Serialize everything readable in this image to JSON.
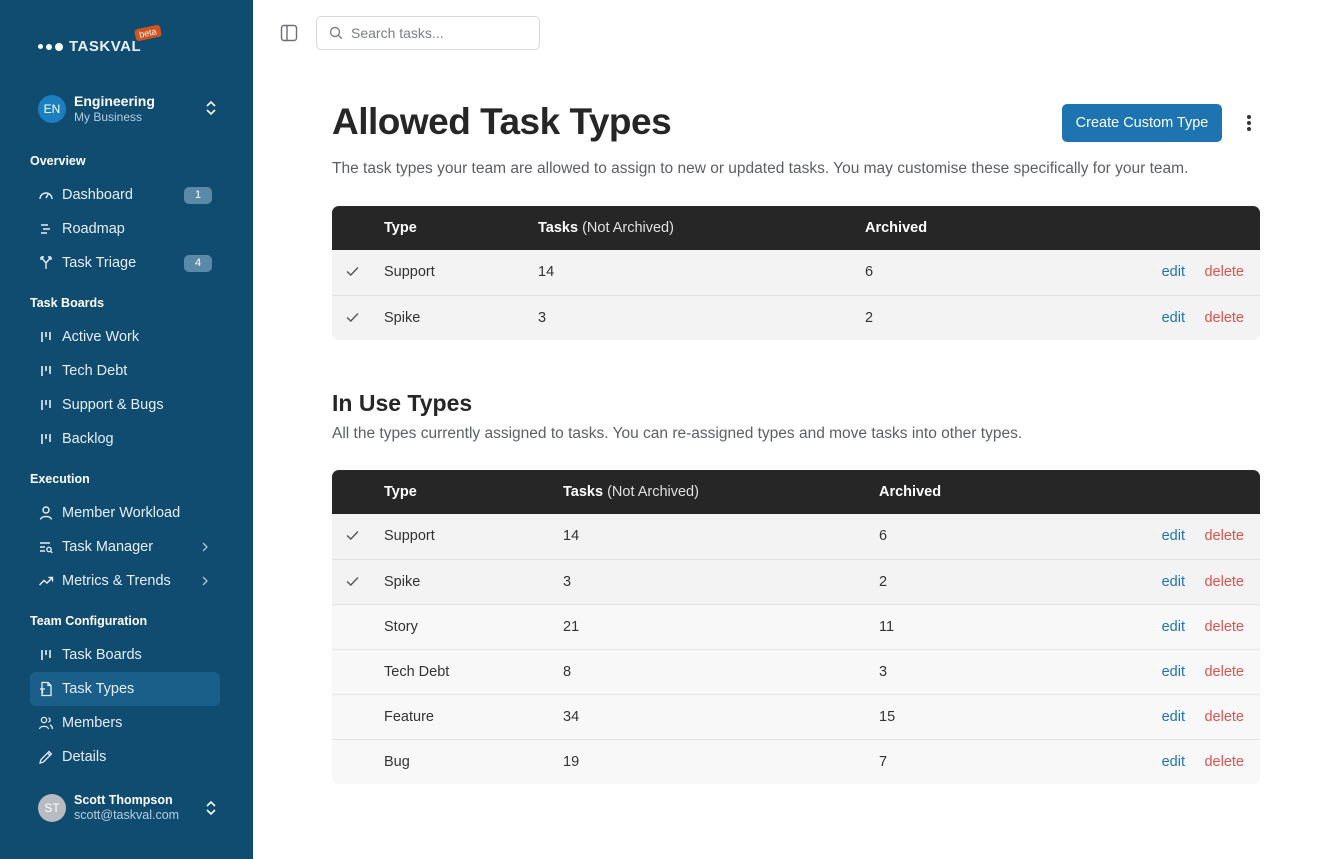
{
  "app": {
    "logo": "TASKVAL",
    "beta": "beta"
  },
  "workspace": {
    "initials": "EN",
    "name": "Engineering",
    "subtitle": "My Business"
  },
  "sidebar": {
    "overview_title": "Overview",
    "dashboard": "Dashboard",
    "dashboard_badge": "1",
    "roadmap": "Roadmap",
    "task_triage": "Task Triage",
    "task_triage_badge": "4",
    "boards_title": "Task Boards",
    "active_work": "Active Work",
    "tech_debt": "Tech Debt",
    "support_bugs": "Support & Bugs",
    "backlog": "Backlog",
    "execution_title": "Execution",
    "member_workload": "Member Workload",
    "task_manager": "Task Manager",
    "metrics_trends": "Metrics & Trends",
    "config_title": "Team Configuration",
    "task_boards": "Task Boards",
    "task_types": "Task Types",
    "members": "Members",
    "details": "Details"
  },
  "user": {
    "initials": "ST",
    "name": "Scott Thompson",
    "email": "scott@taskval.com"
  },
  "search": {
    "placeholder": "Search tasks..."
  },
  "page": {
    "title": "Allowed Task Types",
    "create_button": "Create Custom Type",
    "description": "The task types your team are allowed to assign to new or updated tasks. You may customise these specifically for your team."
  },
  "allowed_table": {
    "col_type": "Type",
    "col_tasks": "Tasks",
    "col_tasks_note": "(Not Archived)",
    "col_archived": "Archived",
    "rows": [
      {
        "type": "Support",
        "tasks": "14",
        "archived": "6",
        "edit": "edit",
        "delete": "delete"
      },
      {
        "type": "Spike",
        "tasks": "3",
        "archived": "2",
        "edit": "edit",
        "delete": "delete"
      }
    ]
  },
  "in_use": {
    "title": "In Use Types",
    "description": "All the types currently assigned to tasks. You can re-assigned types and move tasks into other types.",
    "col_type": "Type",
    "col_tasks": "Tasks",
    "col_tasks_note": "(Not Archived)",
    "col_archived": "Archived",
    "rows": [
      {
        "type": "Support",
        "tasks": "14",
        "archived": "6",
        "edit": "edit",
        "delete": "delete"
      },
      {
        "type": "Spike",
        "tasks": "3",
        "archived": "2",
        "edit": "edit",
        "delete": "delete"
      },
      {
        "type": "Story",
        "tasks": "21",
        "archived": "11",
        "edit": "edit",
        "delete": "delete"
      },
      {
        "type": "Tech Debt",
        "tasks": "8",
        "archived": "3",
        "edit": "edit",
        "delete": "delete"
      },
      {
        "type": "Feature",
        "tasks": "34",
        "archived": "15",
        "edit": "edit",
        "delete": "delete"
      },
      {
        "type": "Bug",
        "tasks": "19",
        "archived": "7",
        "edit": "edit",
        "delete": "delete"
      }
    ]
  },
  "colors": {
    "sidebar": "#0f4c70",
    "accent": "#1d74b0",
    "danger": "#d9534f",
    "table_header": "#262626"
  }
}
